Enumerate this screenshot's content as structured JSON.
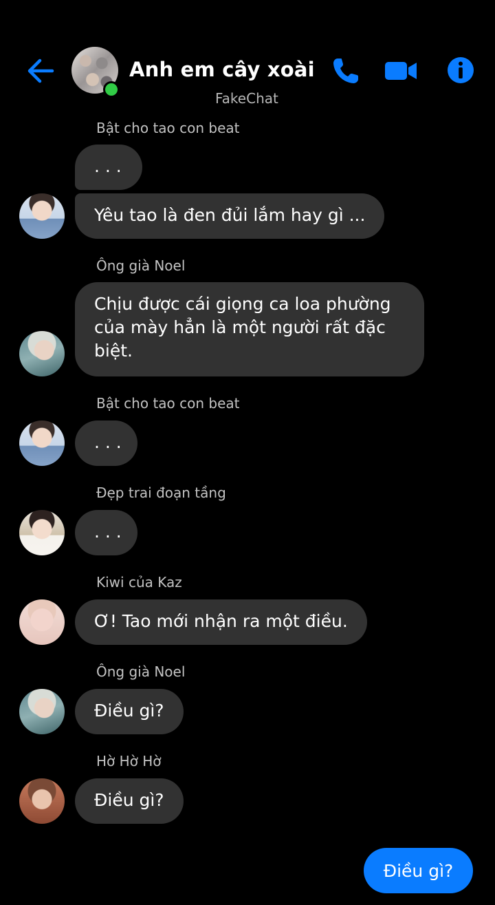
{
  "header": {
    "group_name": "Anh em cây xoài",
    "subtitle": "FakeChat",
    "back_icon": "arrow-left-icon",
    "call_icon": "phone-icon",
    "video_icon": "video-camera-icon",
    "info_icon": "info-icon",
    "accent_color": "#0a7cff",
    "online_color": "#31cc46"
  },
  "messages": [
    {
      "sender": "Bật cho tao con beat",
      "texts": [
        ". . .",
        "Yêu tao là đen đủi lắm hay gì ..."
      ]
    },
    {
      "sender": "Ông già Noel",
      "texts": [
        "Chịu được cái giọng ca loa phường của mày hẳn là một người rất đặc biệt."
      ]
    },
    {
      "sender": "Bật cho tao con beat",
      "texts": [
        ". . ."
      ]
    },
    {
      "sender": "Đẹp trai đoạn tầng",
      "texts": [
        ". . ."
      ]
    },
    {
      "sender": "Kiwi của Kaz",
      "texts": [
        "Ơ! Tao mới nhận ra một điều."
      ]
    },
    {
      "sender": "Ông già Noel",
      "texts": [
        "Điều gì?"
      ]
    },
    {
      "sender": "Hờ Hờ Hờ",
      "texts": [
        "Điều gì?"
      ]
    }
  ],
  "self_message": "Điều gì?",
  "colors": {
    "background": "#000000",
    "incoming_bubble": "#323232",
    "outgoing_bubble": "#0a7cff",
    "sender_label": "#c3c3c3"
  }
}
